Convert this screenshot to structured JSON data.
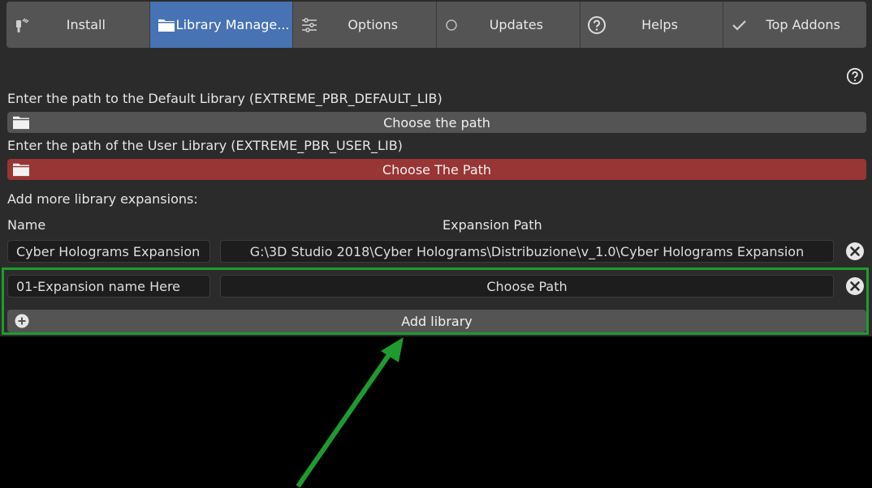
{
  "tabs": [
    {
      "label": "Install",
      "icon": "zipper-icon",
      "active": false
    },
    {
      "label": "Library Manage...",
      "icon": "folder-icon",
      "active": true
    },
    {
      "label": "Options",
      "icon": "sliders-icon",
      "active": false
    },
    {
      "label": "Updates",
      "icon": "circle-icon",
      "active": false
    },
    {
      "label": "Helps",
      "icon": "question-icon",
      "active": false
    },
    {
      "label": "Top Addons",
      "icon": "checkmark-icon",
      "active": false
    }
  ],
  "default_library": {
    "label": "Enter the path to the Default Library (EXTREME_PBR_DEFAULT_LIB)",
    "button": "Choose the path"
  },
  "user_library": {
    "label": "Enter the path of the User Library (EXTREME_PBR_USER_LIB)",
    "button": "Choose The Path"
  },
  "expansions": {
    "heading": "Add more library expansions:",
    "col_name": "Name",
    "col_path": "Expansion Path",
    "rows": [
      {
        "name": "Cyber Holograms Expansion",
        "path": "G:\\3D Studio 2018\\Cyber Holograms\\Distribuzione\\v_1.0\\Cyber Holograms Expansion"
      },
      {
        "name": "01-Expansion name Here",
        "path": "Choose Path"
      }
    ],
    "add_button": "Add library"
  },
  "colors": {
    "active_tab": "#4772b3",
    "warning_button": "#983535",
    "highlight": "#1f9b2e"
  }
}
